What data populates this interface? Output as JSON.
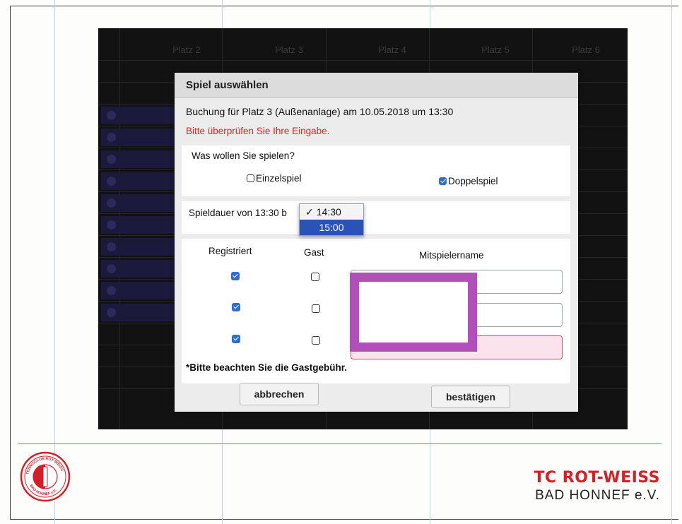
{
  "schedule": {
    "courts": [
      "Platz 2",
      "Platz 3",
      "Platz 4",
      "Platz 5",
      "Platz 6"
    ]
  },
  "dialog": {
    "title": "Spiel auswählen",
    "booking_info": "Buchung für Platz 3 (Außenanlage) am 10.05.2018 um 13:30",
    "error": "Bitte überprüfen Sie Ihre Eingabe.",
    "question": "Was wollen Sie spielen?",
    "single_label": "Einzelspiel",
    "single_checked": false,
    "double_label": "Doppelspiel",
    "double_checked": true,
    "duration_label": "Spieldauer von 13:30 b",
    "duration_options": [
      "14:30",
      "15:00"
    ],
    "duration_selected": "14:30",
    "duration_highlighted": "15:00",
    "col_registered": "Registriert",
    "col_guest": "Gast",
    "col_name": "Mitspielername",
    "players": [
      {
        "registered": true,
        "guest": false,
        "name": ""
      },
      {
        "registered": true,
        "guest": false,
        "name": ""
      },
      {
        "registered": true,
        "guest": false,
        "name": ""
      }
    ],
    "note": "*Bitte beachten Sie die Gastgebühr.",
    "cancel_label": "abbrechen",
    "confirm_label": "bestätigen"
  },
  "footer": {
    "club_line1": "TC ROT-WEISS",
    "club_line2": "BAD HONNEF e.V.",
    "logo_text": "TENNISCLUB ROT-WEISS BAD HONNEF e.V."
  },
  "colors": {
    "accent_red": "#d51f27",
    "checkbox_blue": "#2c6fd1",
    "selection_blue": "#2a53b7",
    "redaction_purple": "#b24fbb"
  }
}
